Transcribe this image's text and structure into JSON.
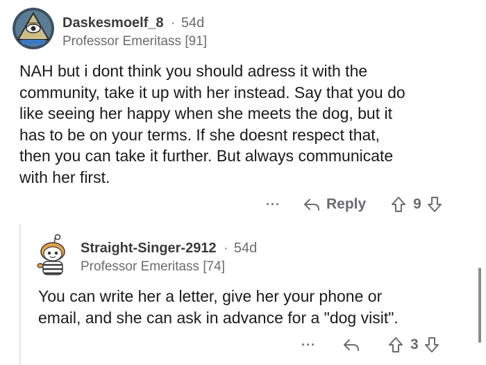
{
  "comments": [
    {
      "username": "Daskesmoelf_8",
      "separator": "·",
      "age": "54d",
      "flair": "Professor Emeritass [91]",
      "body_lines": [
        "NAH but i dont think you should adress it with the",
        "community, take it up with her instead. Say that you do",
        "like seeing her happy when she meets the dog, but it",
        "has to be on your terms. If she doesnt respect that,",
        "then you can take it further. But always communicate",
        "with her first."
      ],
      "more_label": "···",
      "reply_label": "Reply",
      "score": "9"
    },
    {
      "username": "Straight-Singer-2912",
      "separator": "·",
      "age": "54d",
      "flair": "Professor Emeritass [74]",
      "body_lines": [
        "You can write her a letter, give her your phone or",
        "email, and she can ask in advance for a \"dog visit\"."
      ],
      "more_label": "···",
      "score": "3"
    }
  ],
  "icons": {
    "avatar1": "illuminati-eye-avatar-icon",
    "avatar2": "snoo-avatar-icon",
    "reply": "reply-arrow-icon",
    "upvote": "upvote-arrow-icon",
    "downvote": "downvote-arrow-icon"
  },
  "colors": {
    "text": "#1a1a1b",
    "meta": "#6b6b6f",
    "thread_line": "#e4e4e6"
  }
}
